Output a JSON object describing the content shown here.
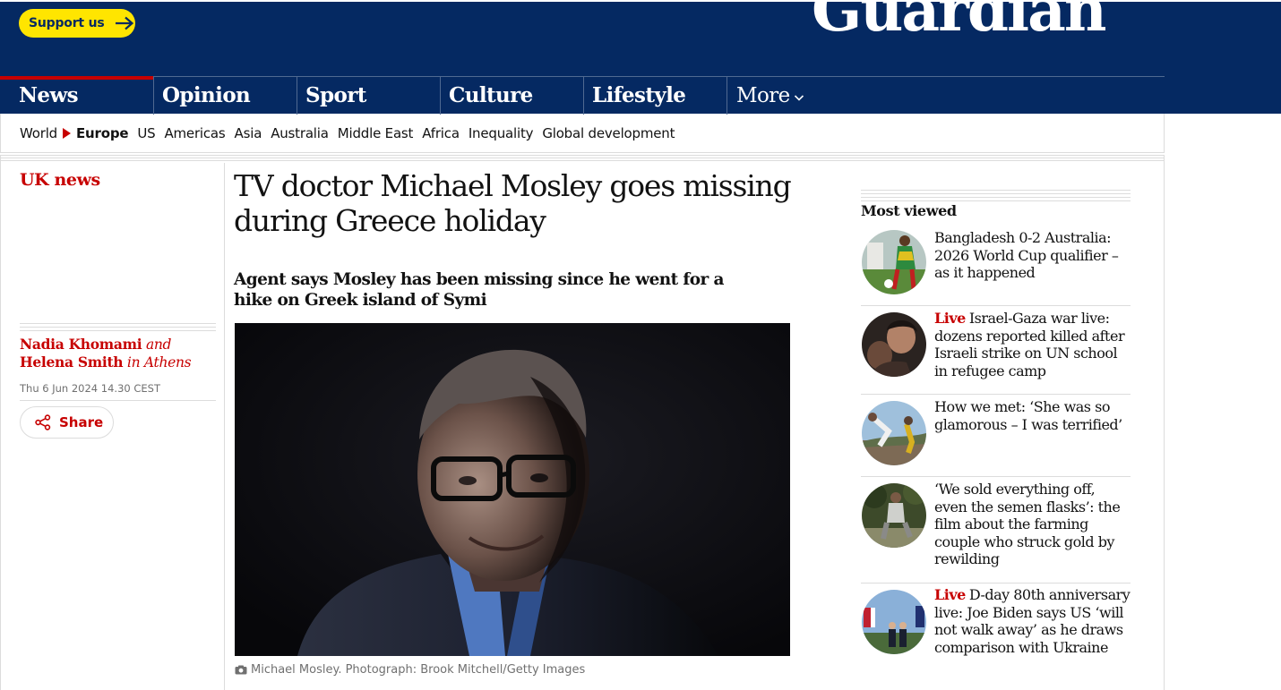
{
  "masthead": {
    "support_label": "Support us",
    "logo_text": "Guardian"
  },
  "pillars": [
    {
      "label": "News",
      "active": true
    },
    {
      "label": "Opinion"
    },
    {
      "label": "Sport"
    },
    {
      "label": "Culture"
    },
    {
      "label": "Lifestyle"
    },
    {
      "label": "More"
    }
  ],
  "subnav": [
    "World",
    "Europe",
    "US",
    "Americas",
    "Asia",
    "Australia",
    "Middle East",
    "Africa",
    "Inequality",
    "Global development"
  ],
  "article": {
    "section": "UK news",
    "headline": "TV doctor Michael Mosley goes missing during Greece holiday",
    "standfirst": "Agent says Mosley has been missing since he went for a hike on Greek island of Symi",
    "byline": {
      "author1": "Nadia Khomami",
      "and": "and",
      "author2": "Helena Smith",
      "location": "in Athens"
    },
    "date": "Thu 6 Jun 2024 14.30 CEST",
    "share_label": "Share",
    "caption": "Michael Mosley. Photograph: Brook Mitchell/Getty Images"
  },
  "most_viewed": {
    "title": "Most viewed",
    "items": [
      {
        "live": "",
        "text": "Bangladesh 0-2 Australia: 2026 World Cup qualifier – as it happened"
      },
      {
        "live": "Live",
        "text": "Israel-Gaza war live: dozens reported killed after Israeli strike on UN school in refugee camp"
      },
      {
        "live": "",
        "text": "How we met: ‘She was so glamorous – I was terrified’"
      },
      {
        "live": "",
        "text": "‘We sold everything off, even the semen flasks’: the film about the farming couple who struck gold by rewilding"
      },
      {
        "live": "Live",
        "text": "D-day 80th anniversary live: Joe Biden says US ‘will not walk away’ as he draws comparison with Ukraine"
      }
    ]
  },
  "colors": {
    "brand_blue": "#052962",
    "news_red": "#c70000",
    "support_yellow": "#ffe500"
  }
}
